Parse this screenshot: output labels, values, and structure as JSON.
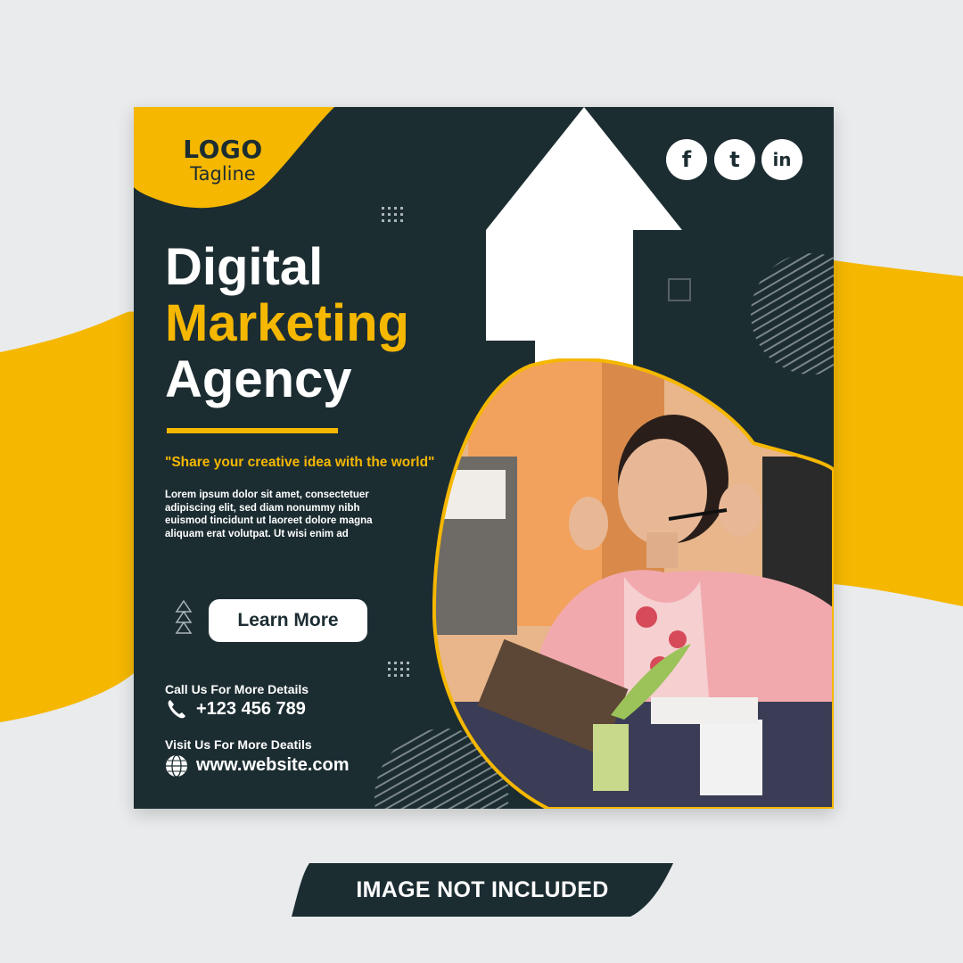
{
  "brand": {
    "logo": "LOGO",
    "tagline": "Tagline"
  },
  "social": [
    {
      "name": "facebook-icon",
      "glyph": "f"
    },
    {
      "name": "twitter-icon",
      "glyph": "t"
    },
    {
      "name": "linkedin-icon",
      "glyph": "in"
    }
  ],
  "headline": {
    "line1": "Digital",
    "line2": "Marketing",
    "line3": "Agency"
  },
  "quote": "\"Share your creative idea with the world\"",
  "body": "Lorem ipsum dolor sit amet, consectetuer adipiscing elit, sed diam nonummy nibh euismod tincidunt ut laoreet dolore magna aliquam erat volutpat. Ut wisi enim ad",
  "cta": {
    "label": "Learn More"
  },
  "contact": {
    "call_label": "Call Us For More Details",
    "phone": "+123 456 789",
    "visit_label": "Visit Us For More Deatils",
    "website": "www.website.com"
  },
  "banner": {
    "text": "IMAGE NOT INCLUDED"
  },
  "colors": {
    "dark": "#1c2d32",
    "accent": "#f5b700",
    "background": "#e9ebec"
  }
}
